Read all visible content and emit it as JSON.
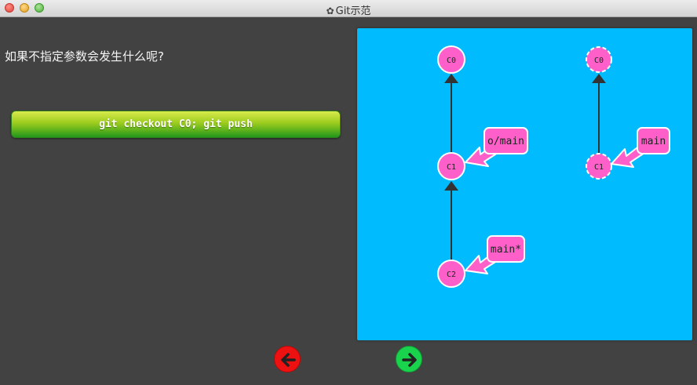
{
  "window": {
    "title": "Git示范",
    "title_icon": "gear-icon"
  },
  "question": "如果不指定参数会发生什么呢?",
  "command_button": "git checkout C0; git push",
  "local_repo": {
    "commits": [
      "C0",
      "C1",
      "C2"
    ],
    "branches": [
      "o/main",
      "main*"
    ]
  },
  "remote_repo": {
    "commits": [
      "C0",
      "C1"
    ],
    "branches": [
      "main"
    ]
  },
  "nav": {
    "back_icon": "arrow-left-icon",
    "forward_icon": "arrow-right-icon"
  },
  "colors": {
    "canvas": "#00bcff",
    "commit": "#ff5fc9",
    "branch_label": "#ff5fc9",
    "back_button": "#ee1111",
    "forward_button": "#19d34c"
  }
}
